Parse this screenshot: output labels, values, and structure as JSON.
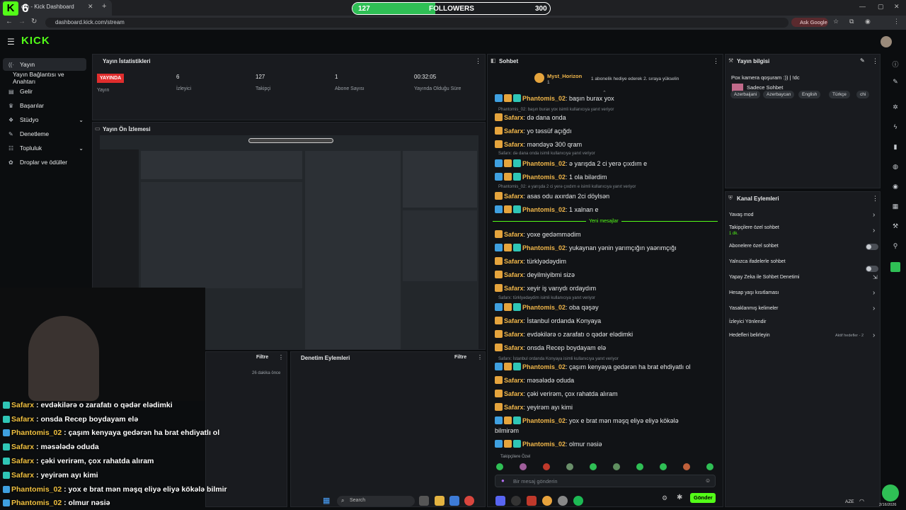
{
  "browser": {
    "tab_title": "om - Kick Dashboard",
    "url": "dashboard.kick.com/stream",
    "ask_google": "Ask Google"
  },
  "followers_goal": {
    "current": "127",
    "label": "FOLLOWERS",
    "target": "300",
    "progress": 0.42
  },
  "stream_overlay_logo": "6",
  "sidebar": {
    "items": [
      {
        "label": "Yayın",
        "icon": "radio-icon"
      },
      {
        "label": "Yayın Bağlantısı ve Anahtarı",
        "icon": ""
      },
      {
        "label": "Gelir",
        "icon": "money-icon"
      },
      {
        "label": "Başarılar",
        "icon": "trophy-icon"
      },
      {
        "label": "Stüdyo",
        "icon": "studio-icon"
      },
      {
        "label": "Denetleme",
        "icon": "gavel-icon"
      },
      {
        "label": "Topluluk",
        "icon": "community-icon"
      },
      {
        "label": "Droplar ve ödüller",
        "icon": "gift-icon"
      }
    ]
  },
  "stats": {
    "title": "Yayın İstatistikleri",
    "status_badge": "YAYINDA",
    "status_label": "Yayın",
    "viewers_value": "6",
    "viewers_label": "İzleyici",
    "followers_value": "127",
    "followers_label": "Takipçi",
    "subs_value": "1",
    "subs_label": "Abone Sayısı",
    "uptime_value": "00:32:05",
    "uptime_label": "Yayında Olduğu Süre"
  },
  "preview": {
    "title": "Yayın Ön İzlemesi"
  },
  "activity": {
    "filter": "Filtre",
    "time": "26 dakika önce"
  },
  "moderation": {
    "title": "Denetim Eylemleri",
    "filter": "Filtre"
  },
  "chat": {
    "title": "Sohbet",
    "pinned_user": "Myst_Horizon",
    "pinned_text": "1 abonelik hediye ederek 2. sıraya yükselin",
    "pinned_count": "1",
    "new_messages": "Yeni mesajlar",
    "followers_only_label": "Takipçilere Özel",
    "input_placeholder": "Bir mesaj gönderin",
    "send_button": "Gönder",
    "lines": [
      {
        "user": "Phantomis_02",
        "text": ": başın burax yox"
      },
      {
        "user": "Safarx",
        "text": ": də dana onda"
      },
      {
        "user": "Safarx",
        "text": ": yo təssüf açığdı"
      },
      {
        "user": "Safarx",
        "text": ": məndəyə 300 qram"
      },
      {
        "user": "Phantomis_02",
        "text": ": ə yarışda 2 ci yerə çıxdım e"
      },
      {
        "user": "Phantomis_02",
        "text": ": 1 ola bilərdim"
      },
      {
        "user": "Safarx",
        "text": ": asas odu axırdan 2ci döylsən"
      },
      {
        "user": "Phantomis_02",
        "text": ": 1 xalnan e"
      },
      {
        "user": "Safarx",
        "text": ": yoxe gedəmmədim"
      },
      {
        "user": "Phantomis_02",
        "text": ": yukaynan yənin yarımçığın yaərımçığı"
      },
      {
        "user": "Safarx",
        "text": ": türklyədəydim"
      },
      {
        "user": "Safarx",
        "text": ": deyilmiyibmi sizə"
      },
      {
        "user": "Safarx",
        "text": ": xeyir iş varıydı ordaydım"
      },
      {
        "user": "Phantomis_02",
        "text": ": oba qəşəy"
      },
      {
        "user": "Safarx",
        "text": ": İstanbul ordanda Konyaya"
      },
      {
        "user": "Safarx",
        "text": ": evdəkilərə o zarafatı o qədər elədimki"
      },
      {
        "user": "Safarx",
        "text": ": onsda Recep boydayam elə"
      },
      {
        "user": "Phantomis_02",
        "text": ": çaşım kenyaya gedərən ha brat ehdiyatlı ol"
      },
      {
        "user": "Safarx",
        "text": ": məsələdə oduda"
      },
      {
        "user": "Safarx",
        "text": ": çəki verirəm, çox rahatda alıram"
      },
      {
        "user": "Safarx",
        "text": ": yeyirəm ayı kimi"
      },
      {
        "user": "Phantomis_02",
        "text": ": yox e brat mən məşq eliyə eliyə kökələ"
      },
      {
        "user": "Phantomis_02",
        "text": ": olmur nəsiə"
      }
    ],
    "last_wrap": "bilmirəm",
    "replies": [
      "Phantomis_02: başın burax yox isimli kullanıcıya yanıt veriyor",
      "Safarx: də dana onda isimli kullanıcıya yanıt veriyor",
      "Phantomis_02: ə yarışda 2 ci yerə çıxdım e isimli kullanıcıya yanıt veriyor",
      "Safarx: türklyədəydim isimli kullanıcıya yanıt veriyor",
      "Safarx: İstanbul ordanda Konyaya isimli kullanıcıya yanıt veriyor"
    ]
  },
  "stream_info": {
    "title": "Yayın bilgisi",
    "stream_title": "Pox kamera qoşuram :)) | !dc",
    "category": "Sadece Sohbet",
    "tags": [
      "Azerbaijani",
      "Azerbaycan",
      "English",
      "Türkçe",
      "chi"
    ]
  },
  "channel_actions": {
    "title": "Kanal Eylemleri",
    "items": [
      {
        "label": "Yavaş mod"
      },
      {
        "label": "Takipçilere özel sohbet",
        "sub": "1 dk."
      },
      {
        "label": "Abonelere özel sohbet"
      },
      {
        "label": "Yalnızca ifadelerle sohbet"
      },
      {
        "label": "Yapay Zeka ile Sohbet Denetimi"
      },
      {
        "label": "Hesap yaşı kısıtlaması"
      },
      {
        "label": "Yasaklanmış kelimeler"
      },
      {
        "label": "İzleyici Yönlendir"
      },
      {
        "label": "Hedefleri belirleyin",
        "right": "Aktif hedefler - 2"
      }
    ]
  },
  "stream_overlay_chat": [
    {
      "user": "Safarx",
      "text": " : evdəkilərə o zarafatı o qədər elədimki"
    },
    {
      "user": "Safarx",
      "text": " : onsda Recep boydayam elə"
    },
    {
      "user": "Phantomis_02",
      "text": " : çaşım kenyaya gedərən ha brat ehdiyatlı ol"
    },
    {
      "user": "Safarx",
      "text": " : məsələdə oduda"
    },
    {
      "user": "Safarx",
      "text": " : çəki verirəm, çox rahatda alıram"
    },
    {
      "user": "Safarx",
      "text": " : yeyirəm ayı kimi"
    },
    {
      "user": "Phantomis_02",
      "text": " : yox e brat mən məşq eliyə eliyə kökələ bilmir"
    },
    {
      "user": "Phantomis_02",
      "text": " : olmur nəsiə"
    }
  ],
  "taskbar": {
    "search": "Search",
    "lang": "AZE",
    "date": "2/16/2026"
  },
  "colors": {
    "kick_green": "#53fc18",
    "live_red": "#e02d2d",
    "username": "#f0b64a",
    "panel": "#191b1f"
  }
}
